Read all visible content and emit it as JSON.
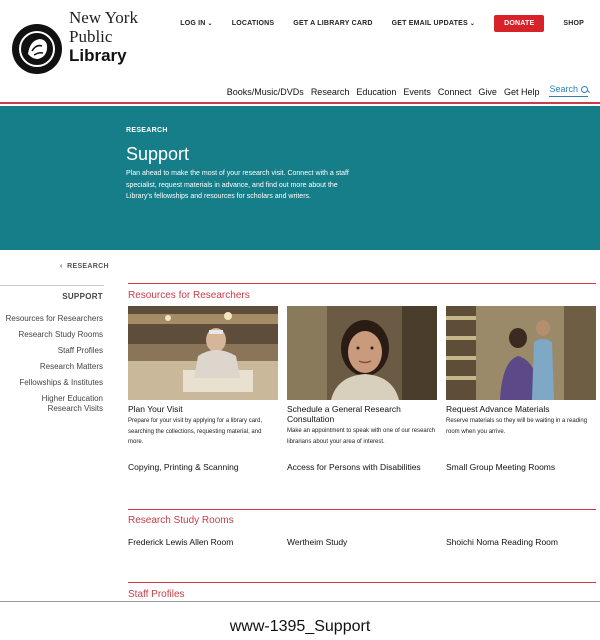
{
  "logo": {
    "line1": "New York",
    "line2": "Public",
    "line3": "Library",
    "icon": "lion-icon"
  },
  "utility_nav": {
    "login": "LOG IN",
    "locations": "LOCATIONS",
    "library_card": "GET A LIBRARY CARD",
    "email_updates": "GET EMAIL UPDATES",
    "donate": "DONATE",
    "shop": "SHOP"
  },
  "main_nav": {
    "items": [
      "Books/Music/DVDs",
      "Research",
      "Education",
      "Events",
      "Connect",
      "Give",
      "Get Help"
    ],
    "search": "Search"
  },
  "hero": {
    "eyebrow": "RESEARCH",
    "title": "Support",
    "description": "Plan ahead to make the most of your research visit. Connect with a staff specialist, request materials in advance, and find out more about the Library's fellowships and resources for scholars and writers."
  },
  "sidebar": {
    "breadcrumb": "RESEARCH",
    "heading": "SUPPORT",
    "items": [
      "Resources for Researchers",
      "Research Study Rooms",
      "Staff Profiles",
      "Research Matters",
      "Fellowships & Institutes",
      "Higher Education Research Visits"
    ]
  },
  "sections": {
    "resources": {
      "title": "Resources for Researchers",
      "cards": [
        {
          "title": "Plan Your Visit",
          "desc": "Prepare for your visit by applying for a library card, searching the collections, requesting material, and more."
        },
        {
          "title": "Schedule a General Research Consultation",
          "desc": "Make an appointment to speak with one of our research librarians about your area of interest."
        },
        {
          "title": "Request Advance Materials",
          "desc": "Reserve materials so they will be waiting in a reading room when you arrive."
        }
      ],
      "links": [
        "Copying, Printing & Scanning",
        "Access for Persons with Disabilities",
        "Small Group Meeting Rooms"
      ]
    },
    "study_rooms": {
      "title": "Research Study Rooms",
      "links": [
        "Frederick Lewis Allen Room",
        "Wertheim Study",
        "Shoichi Noma Reading Room"
      ]
    },
    "staff": {
      "title": "Staff Profiles"
    }
  },
  "caption": "www-1395_Support",
  "colors": {
    "accent_red": "#c93c48",
    "hero_teal": "#167e88",
    "donate_red": "#d8222a",
    "search_blue": "#2d7fbd"
  }
}
